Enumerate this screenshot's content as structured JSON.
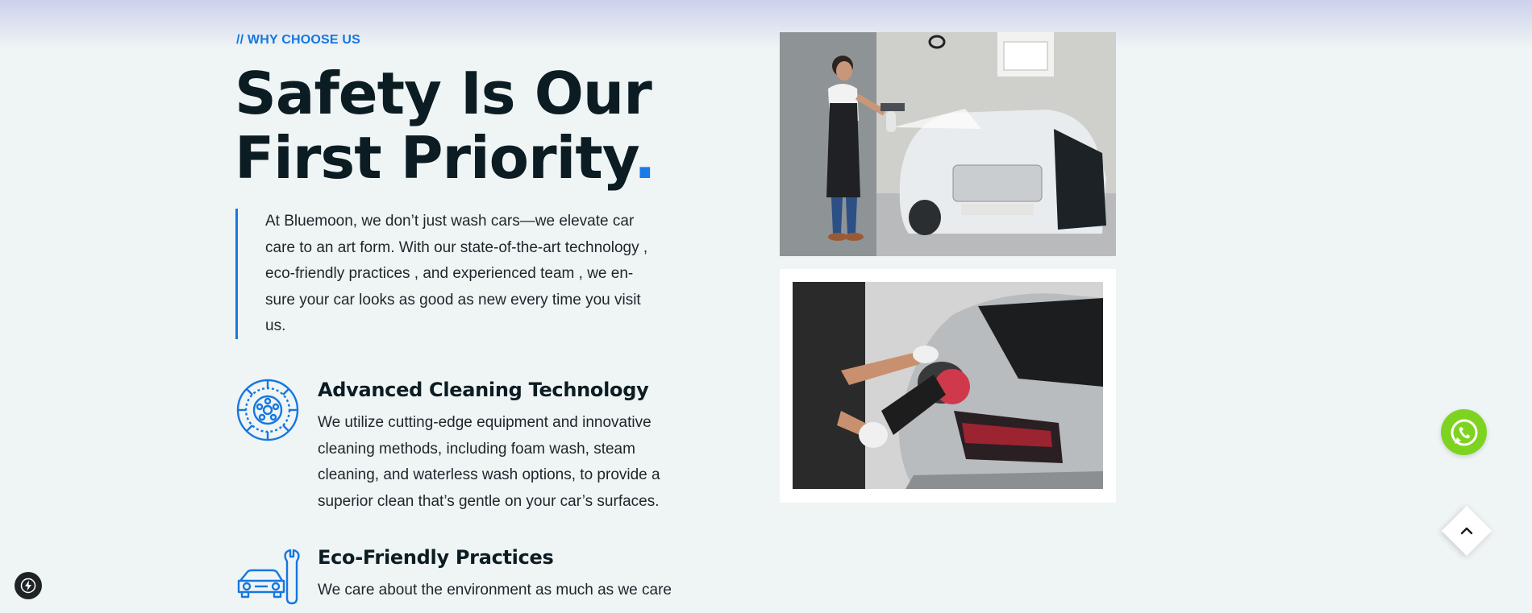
{
  "section": {
    "eyebrow": "// WHY CHOOSE US",
    "title_main": "Safety Is Our First Priority",
    "title_dot": ".",
    "intro": "At Bluemoon, we don’t just wash cars—we elevate car care to an art form. With our state-of-the-art technology , eco-friendly practices , and experienced team , we en-sure your car looks as good as new every time you visit us."
  },
  "features": [
    {
      "title": "Advanced Cleaning Technology",
      "text": "We utilize cutting-edge equipment and innovative cleaning methods, including foam wash, steam cleaning, and waterless wash options, to provide a superior clean that’s gentle on your car’s surfaces.",
      "icon": "wheel-gear-icon"
    },
    {
      "title": "Eco-Friendly Practices",
      "text": "We care about the environment as much as we care",
      "icon": "car-wrench-icon"
    }
  ],
  "images": {
    "photo1": "man-foam-washing-car-photo",
    "photo2": "polishing-car-tail-photo"
  },
  "floating": {
    "whatsapp_icon": "whatsapp-icon",
    "scroll_icon": "chevron-up-icon",
    "bolt_icon": "lightning-icon"
  },
  "colors": {
    "accent": "#1677e0",
    "whatsapp": "#7ed321",
    "background": "#eff4f5",
    "heading": "#0b1c22"
  }
}
